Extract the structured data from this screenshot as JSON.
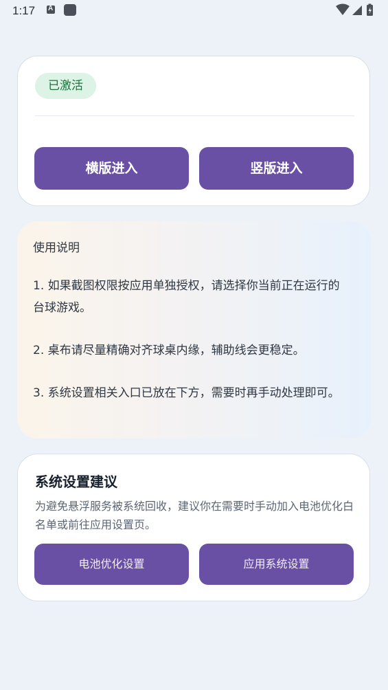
{
  "status_bar": {
    "time": "1:17",
    "icons": [
      "text-recognition-icon",
      "app-square-icon",
      "wifi-icon",
      "signal-icon",
      "battery-charging-icon"
    ]
  },
  "activation_card": {
    "badge": "已激活",
    "landscape_button": "横版进入",
    "portrait_button": "竖版进入"
  },
  "instructions": {
    "title": "使用说明",
    "items": [
      "1. 如果截图权限按应用单独授权，请选择你当前正在运行的台球游戏。",
      "2. 桌布请尽量精确对齐球桌内缘，辅助线会更稳定。",
      "3. 系统设置相关入口已放在下方，需要时再手动处理即可。"
    ]
  },
  "system_settings": {
    "title": "系统设置建议",
    "description": "为避免悬浮服务被系统回收，建议你在需要时手动加入电池优化白名单或前往应用设置页。",
    "battery_button": "电池优化设置",
    "app_settings_button": "应用系统设置"
  },
  "colors": {
    "background": "#edf1f8",
    "primary_button": "#6950a4",
    "badge_bg": "#dcf3e5",
    "badge_text": "#19733f"
  }
}
